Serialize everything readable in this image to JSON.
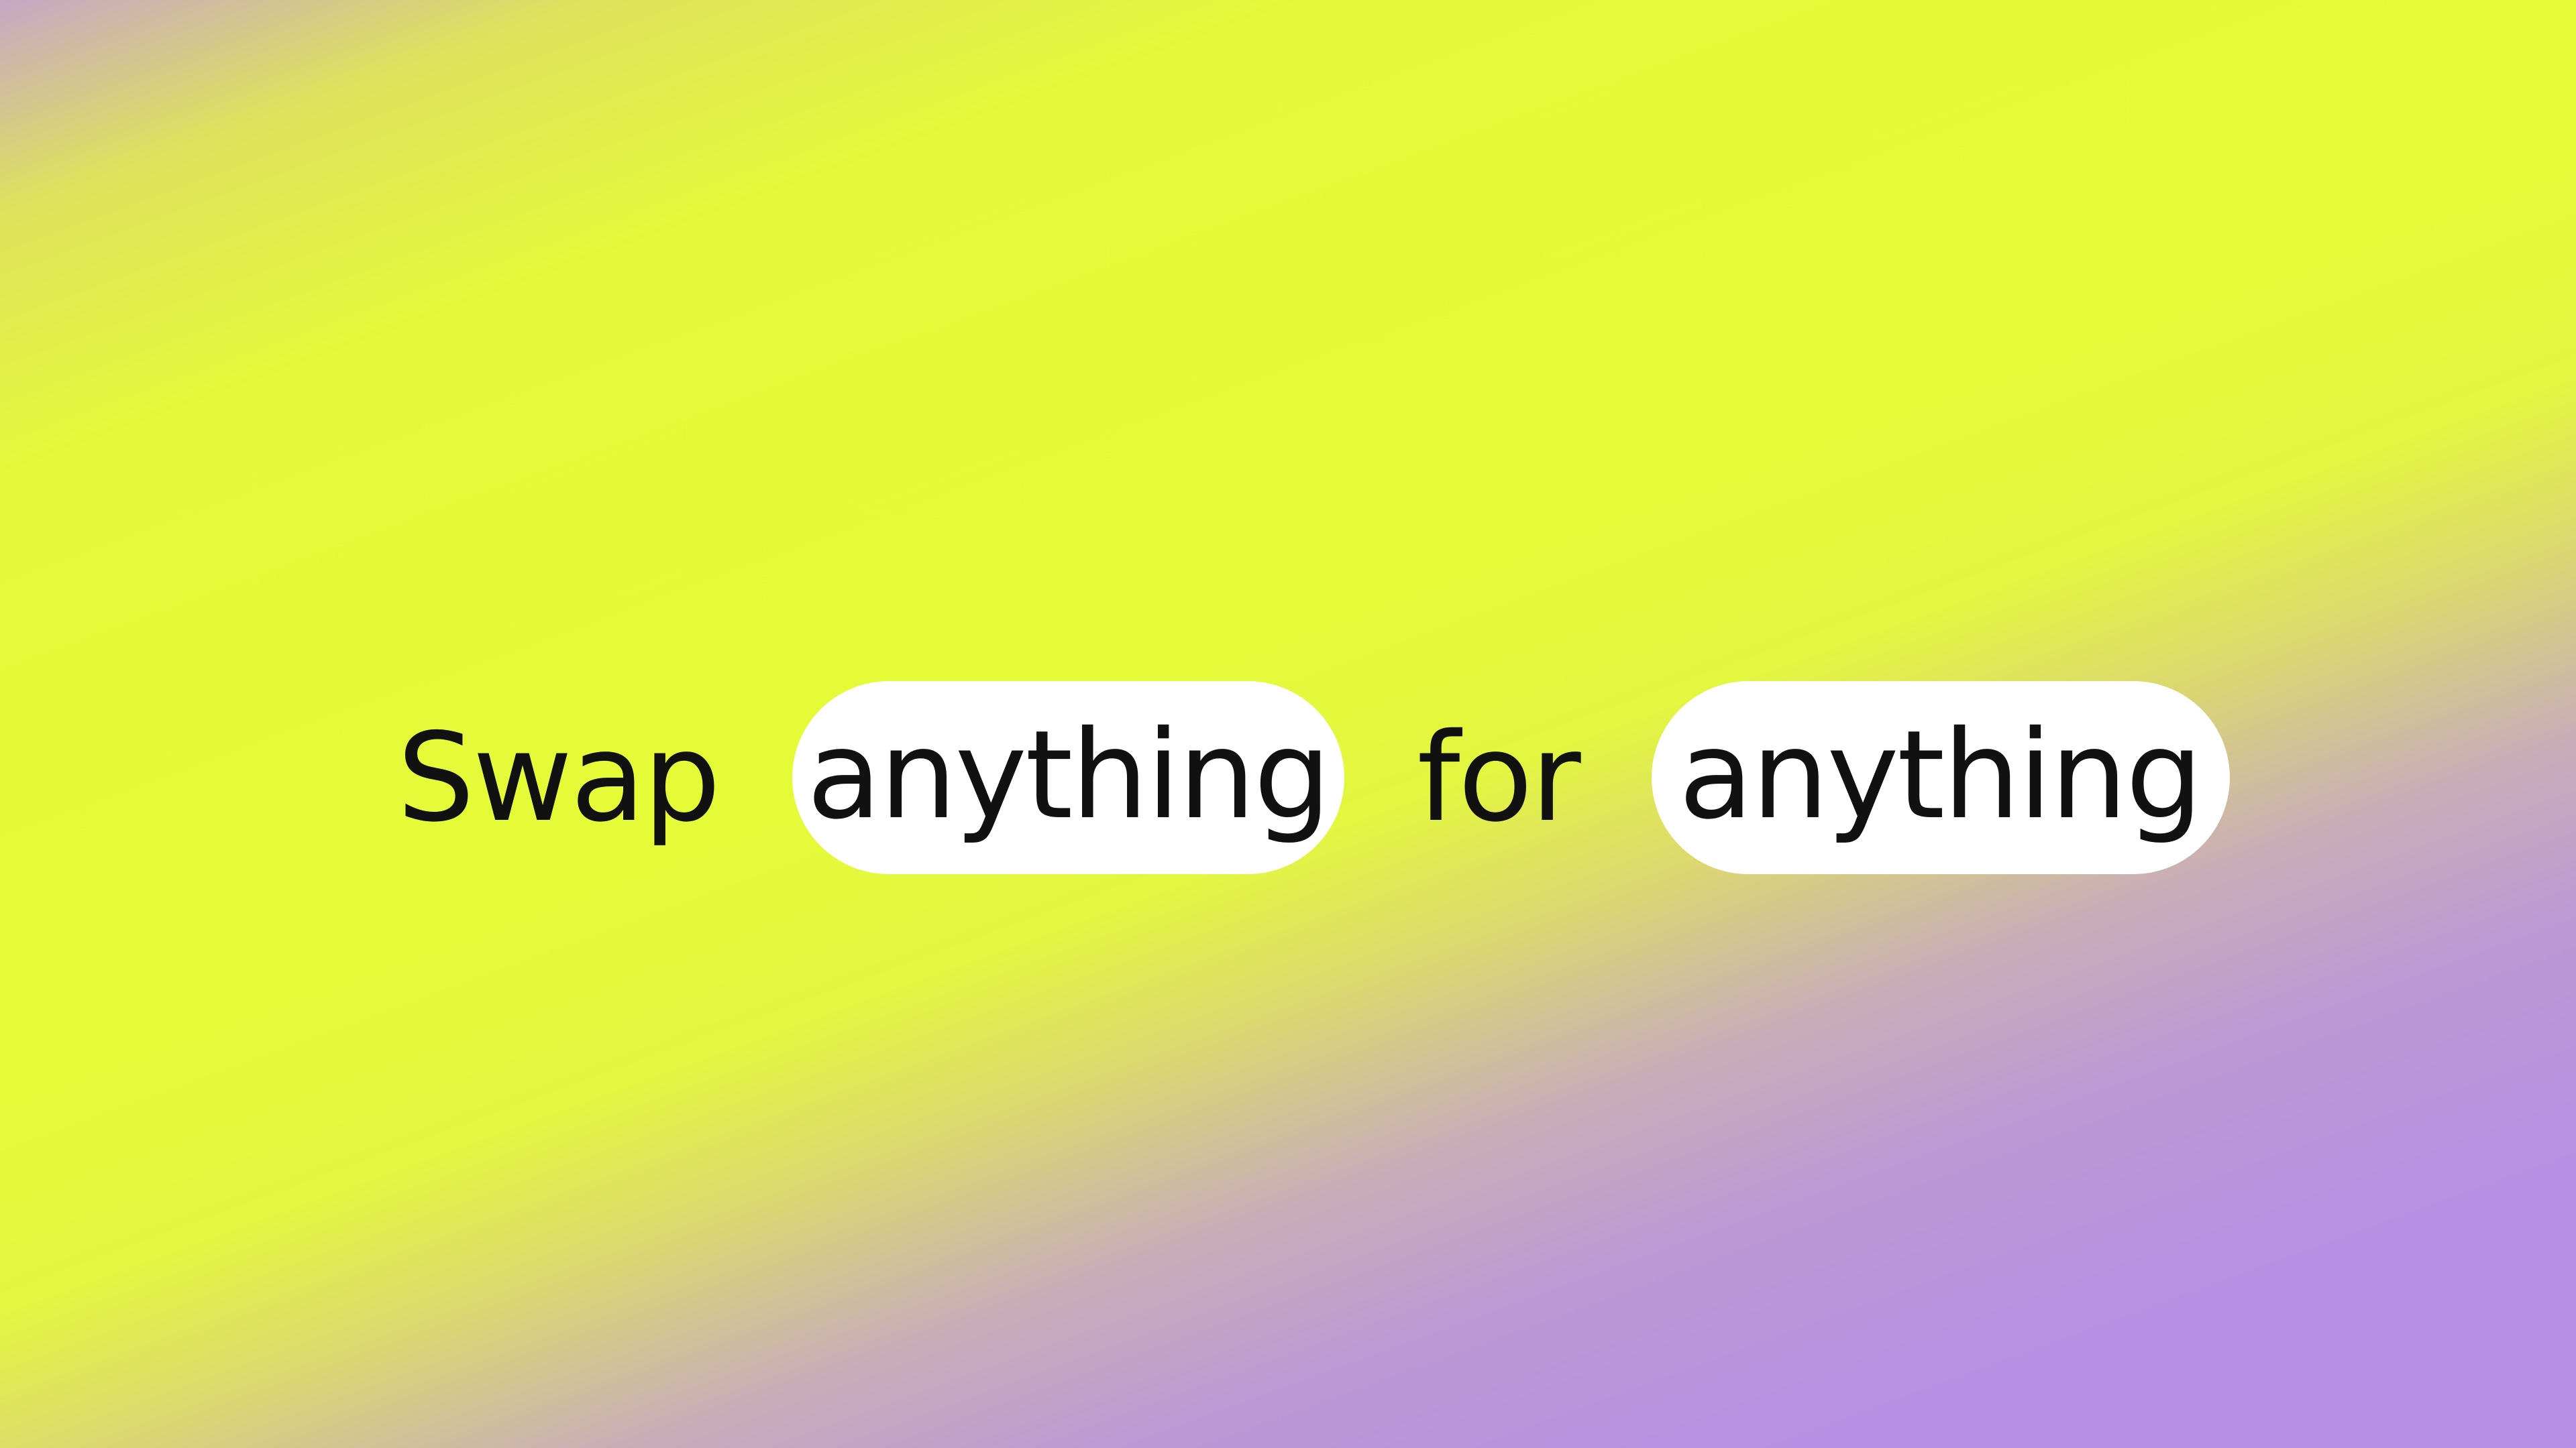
{
  "headline": {
    "word_1": "Swap",
    "pill_1": "anything",
    "word_2": "for",
    "pill_2": "anything"
  },
  "colors": {
    "gradient_yellow": "#e5fb38",
    "gradient_purple": "#b98fe3",
    "pill_background": "#ffffff",
    "text": "#111111"
  }
}
